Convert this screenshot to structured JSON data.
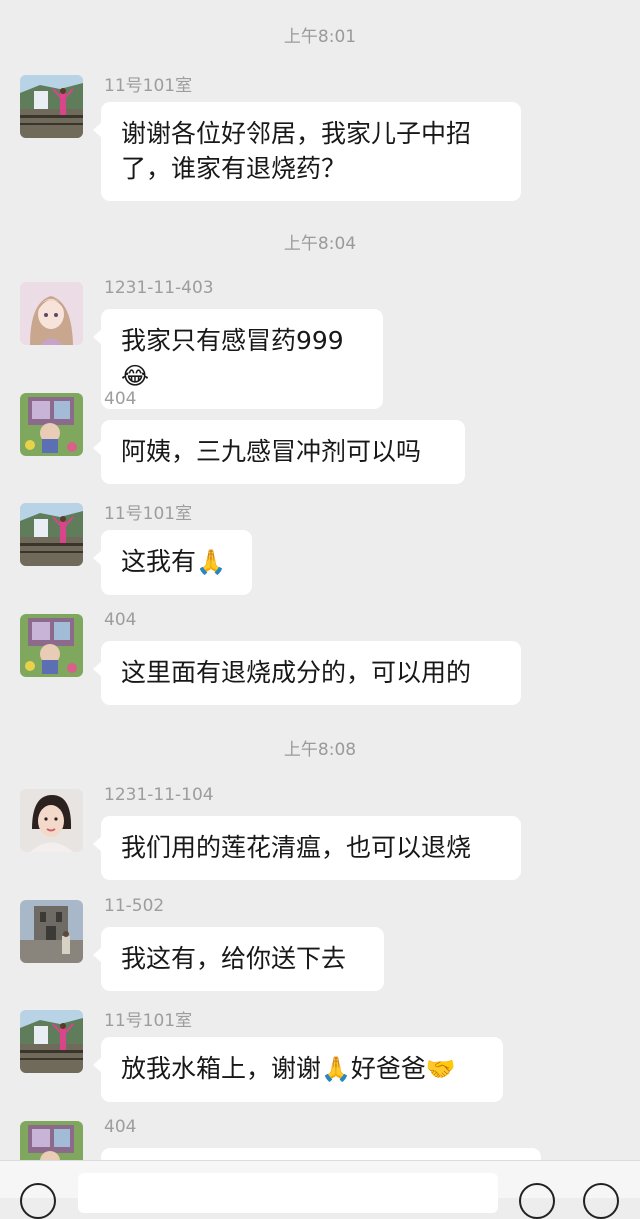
{
  "chat": {
    "timestamps": [
      "上午8:01",
      "上午8:04",
      "上午8:08"
    ],
    "messages": [
      {
        "sender": "11号101室",
        "line1": "谢谢各位好邻居，我家儿子中招",
        "line2": "了，谁家有退烧药？"
      },
      {
        "sender": "1231-11-403",
        "text": "我家只有感冒药999",
        "emoji": "😂"
      },
      {
        "sender": "404",
        "text": "阿姨，三九感冒冲剂可以吗"
      },
      {
        "sender": "11号101室",
        "text": "这我有",
        "emoji": "🙏"
      },
      {
        "sender": "404",
        "text": "这里面有退烧成分的，可以用的"
      },
      {
        "sender": "1231-11-104",
        "text": "我们用的莲花清瘟，也可以退烧"
      },
      {
        "sender": "11-502",
        "text": "我这有，给你送下去"
      },
      {
        "sender": "11号101室",
        "text_a": "放我水箱上，谢谢",
        "emoji_a": "🙏",
        "text_b": "好爸爸",
        "emoji_b": "🤝"
      },
      {
        "sender": "404"
      }
    ]
  },
  "input_bar": {
    "icons": [
      "voice-icon",
      "emoji-icon",
      "plus-icon"
    ]
  }
}
